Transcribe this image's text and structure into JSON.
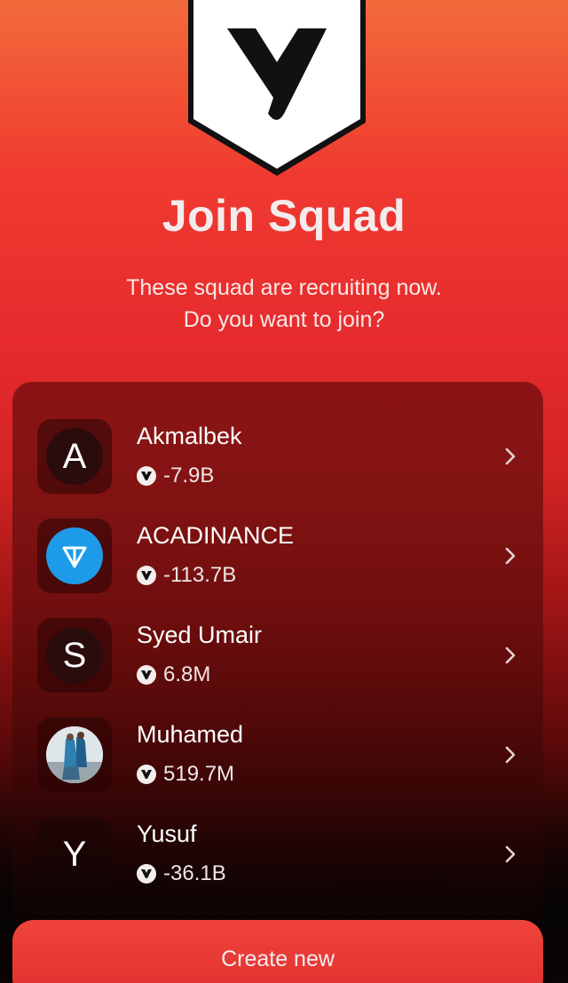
{
  "header": {
    "logo_icon": "shield-v-logo-icon",
    "title": "Join Squad",
    "subtitle_line1": "These squad are recruiting now.",
    "subtitle_line2": "Do you want to join?"
  },
  "squads": [
    {
      "name": "Akmalbek",
      "score": "-7.9B",
      "avatar_letter": "A",
      "avatar_type": "letter"
    },
    {
      "name": "ACADINANCE",
      "score": "-113.7B",
      "avatar_type": "ton-icon"
    },
    {
      "name": "Syed Umair",
      "score": "6.8M",
      "avatar_letter": "S",
      "avatar_type": "letter"
    },
    {
      "name": "Muhamed",
      "score": "519.7M",
      "avatar_type": "photo"
    },
    {
      "name": "Yusuf",
      "score": "-36.1B",
      "avatar_letter": "Y",
      "avatar_type": "letter"
    }
  ],
  "actions": {
    "create_label": "Create new"
  },
  "colors": {
    "accent": "#e8332f",
    "ton_blue": "#1e9be8"
  }
}
